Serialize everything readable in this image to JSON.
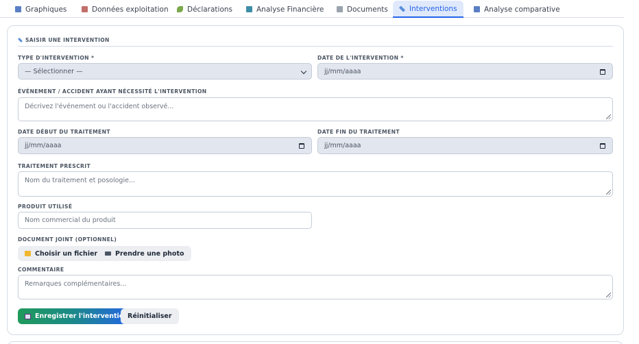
{
  "tabs": [
    {
      "label": "Graphiques",
      "icon": "bar-chart-icon",
      "color": "#5b7fc4"
    },
    {
      "label": "Données exploitation",
      "icon": "document-icon",
      "color": "#c2706b"
    },
    {
      "label": "Déclarations",
      "icon": "leaf-icon",
      "color": "#7aa84b"
    },
    {
      "label": "Analyse Financière",
      "icon": "money-icon",
      "color": "#3f8ea8"
    },
    {
      "label": "Documents",
      "icon": "file-icon",
      "color": "#9aa3ad"
    },
    {
      "label": "Interventions",
      "icon": "syringe-icon",
      "color": "#5b8fd9"
    },
    {
      "label": "Analyse comparative",
      "icon": "chart-icon",
      "color": "#5b7fc4"
    }
  ],
  "active_tab": "Interventions",
  "form": {
    "section_title": "SAISIR UNE INTERVENTION",
    "type_label": "TYPE D'INTERVENTION *",
    "type_value": "— Sélectionner —",
    "date_label": "DATE DE L'INTERVENTION *",
    "date_value": "jj/mm/aaaa",
    "event_label": "ÉVÉNEMENT / ACCIDENT AYANT NÉCESSITÉ L'INTERVENTION",
    "event_placeholder": "Décrivez l'événement ou l'accident observé...",
    "start_label": "DATE DÉBUT DU TRAITEMENT",
    "start_value": "jj/mm/aaaa",
    "end_label": "DATE FIN DU TRAITEMENT",
    "end_value": "jj/mm/aaaa",
    "treatment_label": "TRAITEMENT PRESCRIT",
    "treatment_placeholder": "Nom du traitement et posologie...",
    "product_label": "PRODUIT UTILISÉ",
    "product_placeholder": "Nom commercial du produit",
    "attachment_label": "DOCUMENT JOINT (OPTIONNEL)",
    "choose_file": "Choisir un fichier",
    "take_photo": "Prendre une photo",
    "comment_label": "COMMENTAIRE",
    "comment_placeholder": "Remarques complémentaires...",
    "save": "Enregistrer l'intervention",
    "reset": "Réinitialiser"
  },
  "colors": {
    "accent": "#2563eb",
    "save_gradient_start": "#1f9a5a",
    "active_tab_bg": "#dfe9fb"
  }
}
